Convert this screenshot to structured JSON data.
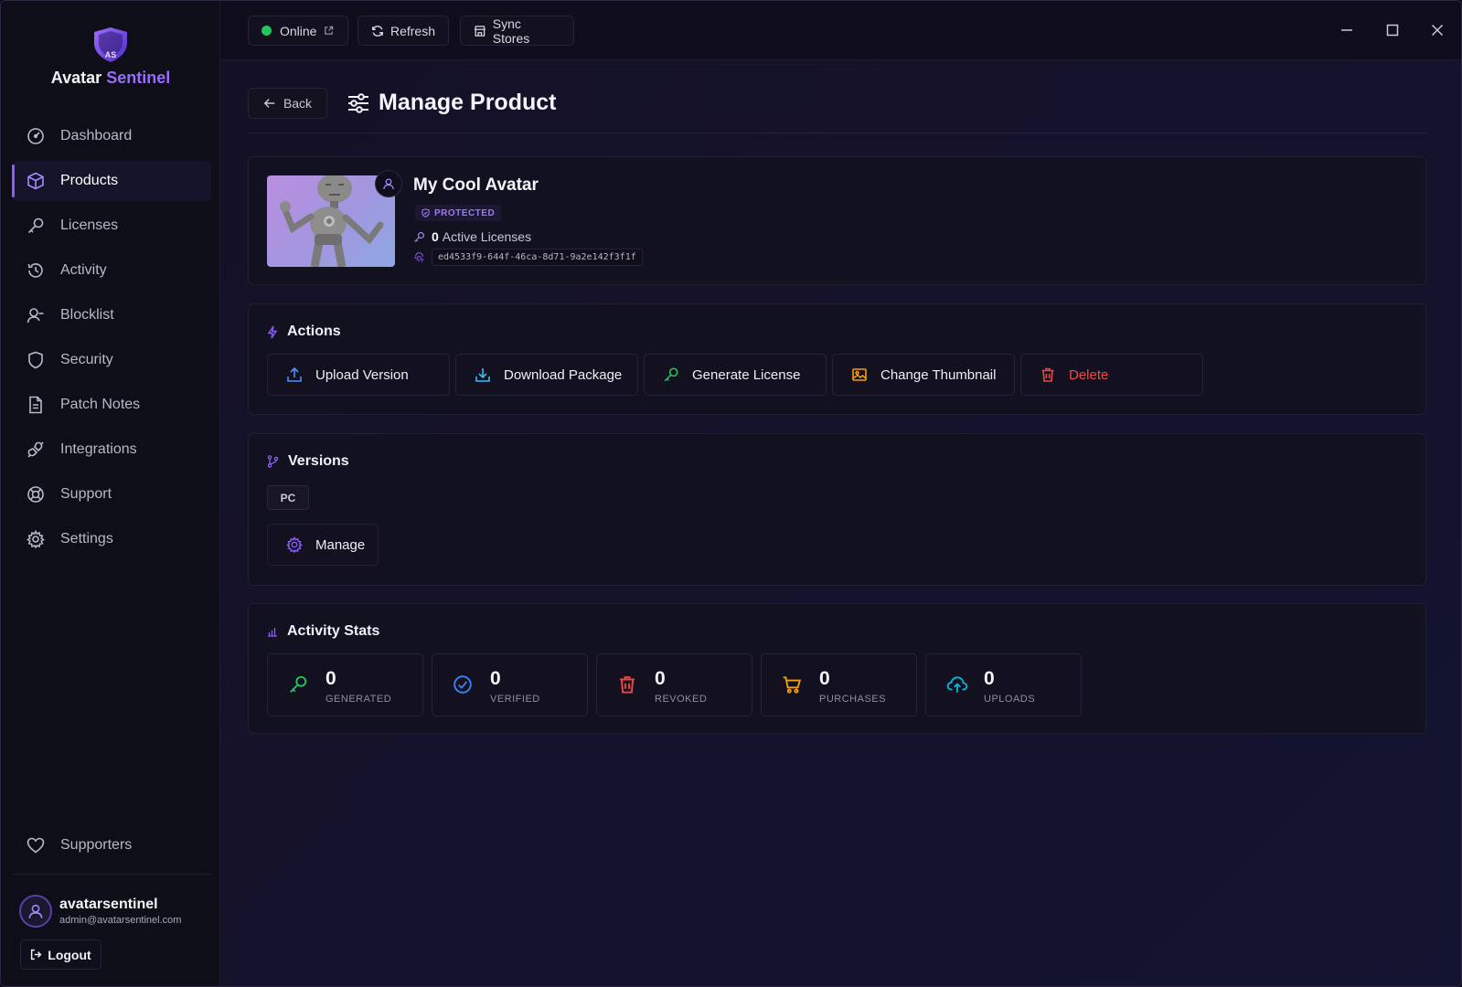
{
  "app": {
    "brand_first": "Avatar",
    "brand_second": "Sentinel",
    "logo_letters": "AS",
    "accent_color": "#8b5cf6"
  },
  "sidebar": {
    "items": [
      {
        "label": "Dashboard",
        "icon": "gauge-icon"
      },
      {
        "label": "Products",
        "icon": "box-icon",
        "active": true
      },
      {
        "label": "Licenses",
        "icon": "key-icon"
      },
      {
        "label": "Activity",
        "icon": "history-icon"
      },
      {
        "label": "Blocklist",
        "icon": "user-minus-icon"
      },
      {
        "label": "Security",
        "icon": "shield-icon"
      },
      {
        "label": "Patch Notes",
        "icon": "document-icon"
      },
      {
        "label": "Integrations",
        "icon": "plug-icon"
      },
      {
        "label": "Support",
        "icon": "lifebuoy-icon"
      },
      {
        "label": "Settings",
        "icon": "gear-icon"
      }
    ],
    "supporters_label": "Supporters",
    "user": {
      "name": "avatarsentinel",
      "email": "admin@avatarsentinel.com"
    },
    "logout_label": "Logout"
  },
  "topbar": {
    "online_label": "Online",
    "refresh_label": "Refresh",
    "sync_label": "Sync Stores"
  },
  "page": {
    "back_label": "Back",
    "title": "Manage Product"
  },
  "product": {
    "name": "My Cool Avatar",
    "status": "PROTECTED",
    "active_licenses_count": "0",
    "active_licenses_label": "Active Licenses",
    "id": "ed4533f9-644f-46ca-8d71-9a2e142f3f1f"
  },
  "actions": {
    "title": "Actions",
    "buttons": [
      {
        "label": "Upload Version",
        "icon": "upload-icon",
        "color": "#4f8ff7"
      },
      {
        "label": "Download Package",
        "icon": "download-icon",
        "color": "#38bdf8"
      },
      {
        "label": "Generate License",
        "icon": "key-icon",
        "color": "#22c55e"
      },
      {
        "label": "Change Thumbnail",
        "icon": "image-icon",
        "color": "#f59e0b"
      },
      {
        "label": "Delete",
        "icon": "trash-icon",
        "color": "#ef4444"
      }
    ]
  },
  "versions": {
    "title": "Versions",
    "platform": "PC",
    "manage_label": "Manage"
  },
  "stats": {
    "title": "Activity Stats",
    "items": [
      {
        "value": "0",
        "label": "GENERATED",
        "icon": "key-icon",
        "color": "#22c55e"
      },
      {
        "value": "0",
        "label": "VERIFIED",
        "icon": "check-circle-icon",
        "color": "#3b82f6"
      },
      {
        "value": "0",
        "label": "REVOKED",
        "icon": "trash-icon",
        "color": "#ef4444"
      },
      {
        "value": "0",
        "label": "PURCHASES",
        "icon": "cart-icon",
        "color": "#f59e0b"
      },
      {
        "value": "0",
        "label": "UPLOADS",
        "icon": "cloud-upload-icon",
        "color": "#06b6d4"
      }
    ]
  }
}
